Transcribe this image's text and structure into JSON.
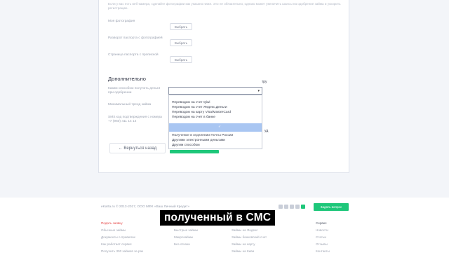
{
  "form": {
    "hint_text": "Если у вас есть веб-камера, сделайте фотографии как указано ниже. Это не обязательно, однако может увеличить шансы на одобрение займа и ускорить регистрацию.",
    "rows": [
      {
        "label": "Моя фотография",
        "button": "Выбрать"
      },
      {
        "label": "Разворот паспорта с фотографией",
        "button": "Выбрать"
      },
      {
        "label": "Страница паспорта с пропиской",
        "button": "Выбрать"
      }
    ],
    "section_title": "Дополнительно",
    "receive_label": "Каким способом получить деньги при одобрении",
    "min_term_label": "Минимальный тренд займа",
    "sms_label": "SMS код подтверждения с номера +7 (960) 411 14 14",
    "side_text": "уд",
    "side_text2": "тру"
  },
  "dropdown": {
    "items": [
      "Переводом на счет Qiwi",
      "Переводом на счет Яндекс.Деньги",
      "Переводом на карту Visa/MasterCard",
      "Переводом на счет в банке",
      "Получение в отделении Почты России",
      "Другими электронными деньгами",
      "Другим способом"
    ],
    "highlight_mark": "✓"
  },
  "buttons": {
    "back": "← Вернуться назад"
  },
  "footer": {
    "copyright": "eKarta.ru © 2013-2017, ООО МФК «Ваш Личный Кредит»",
    "ask_button": "Задать вопрос",
    "col1": {
      "head": "Подать заявку",
      "items": [
        "Обычные займы",
        "Документы о правилах",
        "Как работает сервис",
        "Получить 300 займов за раз"
      ]
    },
    "col2": {
      "head": "Займы на карту",
      "items": [
        "Быстрые займы",
        "Микрозаймы",
        "Без отказа"
      ]
    },
    "col3": {
      "head": "Займы на Qiwi",
      "items": [
        "Займы на Яндекс",
        "Займы банковский счет",
        "Займы на карту",
        "Займы на Киви"
      ]
    },
    "col4": {
      "head": "Сервис",
      "items": [
        "Новости",
        "Статьи",
        "Отзывы",
        "Контакты"
      ]
    }
  },
  "subtitle": "полученный в СМС"
}
